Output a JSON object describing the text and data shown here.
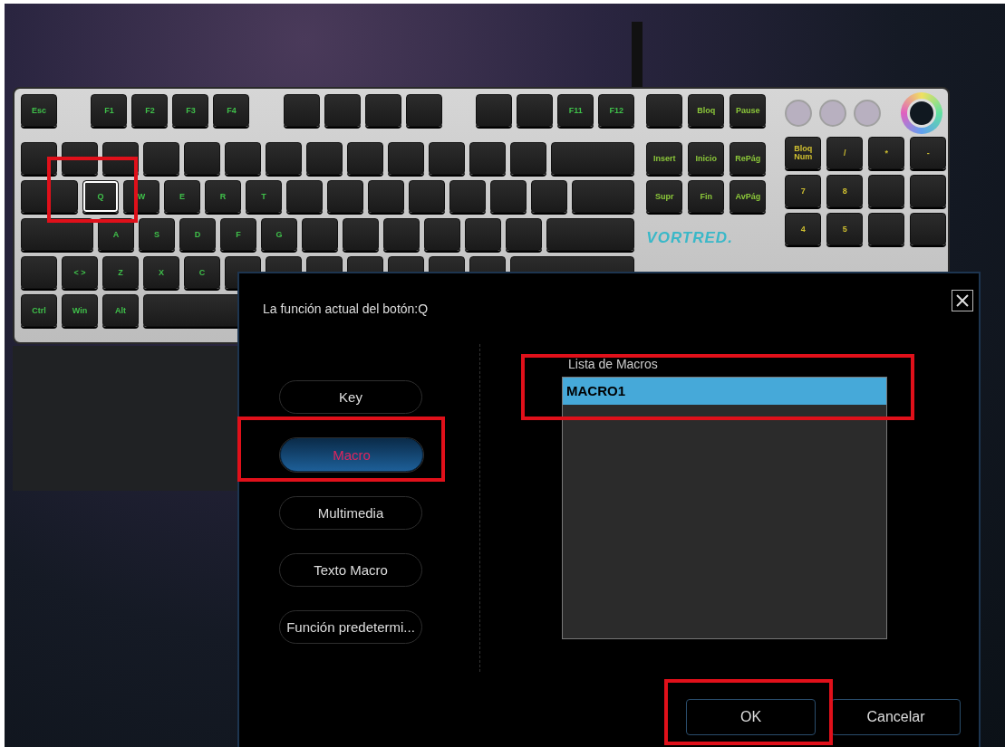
{
  "keyboard": {
    "logo": "VORTRED.",
    "main_rows": [
      [
        [
          {
            "label": "Esc",
            "kind": "key",
            "selected": false,
            "annotated": false
          }
        ],
        [
          {
            "label": "F1",
            "kind": "key",
            "selected": false,
            "annotated": false
          },
          {
            "label": "F2",
            "kind": "key",
            "selected": false,
            "annotated": false
          },
          {
            "label": "F3",
            "kind": "key",
            "selected": false,
            "annotated": false
          },
          {
            "label": "F4",
            "kind": "key",
            "selected": false,
            "annotated": false
          }
        ],
        [
          {
            "kind": "key",
            "selected": false,
            "annotated": false
          },
          {
            "kind": "key",
            "selected": false,
            "annotated": false
          },
          {
            "kind": "key",
            "selected": false,
            "annotated": false
          },
          {
            "kind": "key",
            "selected": false,
            "annotated": false
          }
        ],
        [
          {
            "kind": "key",
            "selected": false,
            "annotated": false
          },
          {
            "kind": "key",
            "selected": false,
            "annotated": false
          },
          {
            "label": "F11",
            "kind": "key",
            "selected": false,
            "annotated": false
          },
          {
            "label": "F12",
            "kind": "key",
            "selected": false,
            "annotated": false
          }
        ]
      ],
      [
        [
          {
            "kind": "key",
            "selected": false,
            "annotated": false
          },
          {
            "kind": "key",
            "selected": false,
            "annotated": false
          },
          {
            "kind": "key",
            "selected": false,
            "annotated": false
          },
          {
            "kind": "key",
            "selected": false,
            "annotated": false
          },
          {
            "kind": "key",
            "selected": false,
            "annotated": false
          },
          {
            "kind": "key",
            "selected": false,
            "annotated": false
          },
          {
            "kind": "key",
            "selected": false,
            "annotated": false
          },
          {
            "kind": "key",
            "selected": false,
            "annotated": false
          },
          {
            "kind": "key",
            "selected": false,
            "annotated": false
          },
          {
            "kind": "key",
            "selected": false,
            "annotated": false
          },
          {
            "kind": "key",
            "selected": false,
            "annotated": false
          },
          {
            "kind": "key",
            "selected": false,
            "annotated": false
          },
          {
            "kind": "key",
            "selected": false,
            "annotated": false
          },
          {
            "kind": "fill",
            "selected": false,
            "annotated": false
          }
        ]
      ],
      [
        [
          {
            "kind": "wide15",
            "selected": false,
            "annotated": false
          },
          {
            "label": "Q",
            "kind": "key",
            "selected": true,
            "annotated": true
          },
          {
            "label": "W",
            "kind": "key",
            "selected": false,
            "annotated": false
          },
          {
            "label": "E",
            "kind": "key",
            "selected": false,
            "annotated": false
          },
          {
            "label": "R",
            "kind": "key",
            "selected": false,
            "annotated": false
          },
          {
            "label": "T",
            "kind": "key",
            "selected": false,
            "annotated": false
          },
          {
            "kind": "key",
            "selected": false,
            "annotated": false
          },
          {
            "kind": "key",
            "selected": false,
            "annotated": false
          },
          {
            "kind": "key",
            "selected": false,
            "annotated": false
          },
          {
            "kind": "key",
            "selected": false,
            "annotated": false
          },
          {
            "kind": "key",
            "selected": false,
            "annotated": false
          },
          {
            "kind": "key",
            "selected": false,
            "annotated": false
          },
          {
            "kind": "key",
            "selected": false,
            "annotated": false
          },
          {
            "kind": "fill",
            "selected": false,
            "annotated": false
          }
        ]
      ],
      [
        [
          {
            "kind": "wide175",
            "selected": false,
            "annotated": false
          },
          {
            "label": "A",
            "kind": "key",
            "selected": false,
            "annotated": false
          },
          {
            "label": "S",
            "kind": "key",
            "selected": false,
            "annotated": false
          },
          {
            "label": "D",
            "kind": "key",
            "selected": false,
            "annotated": false
          },
          {
            "label": "F",
            "kind": "key",
            "selected": false,
            "annotated": false
          },
          {
            "label": "G",
            "kind": "key",
            "selected": false,
            "annotated": false
          },
          {
            "kind": "key",
            "selected": false,
            "annotated": false
          },
          {
            "kind": "key",
            "selected": false,
            "annotated": false
          },
          {
            "kind": "key",
            "selected": false,
            "annotated": false
          },
          {
            "kind": "key",
            "selected": false,
            "annotated": false
          },
          {
            "kind": "key",
            "selected": false,
            "annotated": false
          },
          {
            "kind": "key",
            "selected": false,
            "annotated": false
          },
          {
            "kind": "fill",
            "selected": false,
            "annotated": false
          }
        ]
      ],
      [
        [
          {
            "kind": "key",
            "selected": false,
            "annotated": false
          },
          {
            "label": "< >",
            "kind": "key",
            "selected": false,
            "annotated": false
          },
          {
            "label": "Z",
            "kind": "key",
            "selected": false,
            "annotated": false
          },
          {
            "label": "X",
            "kind": "key",
            "selected": false,
            "annotated": false
          },
          {
            "label": "C",
            "kind": "key",
            "selected": false,
            "annotated": false
          },
          {
            "kind": "key",
            "selected": false,
            "annotated": false
          },
          {
            "kind": "key",
            "selected": false,
            "annotated": false
          },
          {
            "kind": "key",
            "selected": false,
            "annotated": false
          },
          {
            "kind": "key",
            "selected": false,
            "annotated": false
          },
          {
            "kind": "key",
            "selected": false,
            "annotated": false
          },
          {
            "kind": "key",
            "selected": false,
            "annotated": false
          },
          {
            "kind": "key",
            "selected": false,
            "annotated": false
          },
          {
            "kind": "fill",
            "selected": false,
            "annotated": false
          }
        ]
      ],
      [
        [
          {
            "label": "Ctrl",
            "kind": "key",
            "selected": false,
            "annotated": false
          },
          {
            "label": "Win",
            "kind": "key",
            "selected": false,
            "annotated": false
          },
          {
            "label": "Alt",
            "kind": "key",
            "selected": false,
            "annotated": false
          },
          {
            "kind": "fill",
            "selected": false,
            "annotated": false
          }
        ]
      ]
    ],
    "nav_rows": [
      [
        [
          {
            "kind": "key",
            "selected": false,
            "annotated": false
          },
          {
            "label": "Bloq",
            "kind": "key",
            "selected": false,
            "annotated": false
          },
          {
            "label": "Pause",
            "kind": "key",
            "selected": false,
            "annotated": false
          }
        ]
      ],
      [
        [
          {
            "label": "Insert",
            "kind": "key",
            "selected": false,
            "annotated": false
          },
          {
            "label": "Inicio",
            "kind": "key",
            "selected": false,
            "annotated": false
          },
          {
            "label": "RePág",
            "kind": "key",
            "selected": false,
            "annotated": false
          }
        ]
      ],
      [
        [
          {
            "label": "Supr",
            "kind": "key",
            "selected": false,
            "annotated": false
          },
          {
            "label": "Fin",
            "kind": "key",
            "selected": false,
            "annotated": false
          },
          {
            "label": "AvPág",
            "kind": "key",
            "selected": false,
            "annotated": false
          }
        ]
      ]
    ],
    "numpad_rows": [
      [
        [
          {
            "label": "Bloq Num",
            "kind": "key",
            "selected": false,
            "annotated": false
          },
          {
            "label": "/",
            "kind": "key",
            "selected": false,
            "annotated": false
          },
          {
            "label": "*",
            "kind": "key",
            "selected": false,
            "annotated": false
          },
          {
            "label": "-",
            "kind": "key",
            "selected": false,
            "annotated": false
          }
        ]
      ],
      [
        [
          {
            "label": "7",
            "kind": "key",
            "selected": false,
            "annotated": false
          },
          {
            "label": "8",
            "kind": "key",
            "selected": false,
            "annotated": false
          },
          {
            "kind": "key",
            "selected": false,
            "annotated": false
          },
          {
            "kind": "key",
            "selected": false,
            "annotated": false
          }
        ]
      ],
      [
        [
          {
            "label": "4",
            "kind": "key",
            "selected": false,
            "annotated": false
          },
          {
            "label": "5",
            "kind": "key",
            "selected": false,
            "annotated": false
          },
          {
            "kind": "key",
            "selected": false,
            "annotated": false
          },
          {
            "kind": "key",
            "selected": false,
            "annotated": false
          }
        ]
      ]
    ]
  },
  "dialog": {
    "title": "La función actual del botón:Q",
    "options": [
      {
        "label": "Key",
        "selected": false,
        "annotated": false
      },
      {
        "label": "Macro",
        "selected": true,
        "annotated": true
      },
      {
        "label": "Multimedia",
        "selected": false,
        "annotated": false
      },
      {
        "label": "Texto Macro",
        "selected": false,
        "annotated": false
      },
      {
        "label": "Función predetermi...",
        "selected": false,
        "annotated": false
      }
    ],
    "macro_list": {
      "label": "Lista de Macros",
      "items": [
        {
          "label": "MACRO1",
          "selected": true,
          "annotated": true
        }
      ]
    },
    "buttons": [
      {
        "label": "OK",
        "annotated": true
      },
      {
        "label": "Cancelar",
        "annotated": false
      }
    ]
  }
}
